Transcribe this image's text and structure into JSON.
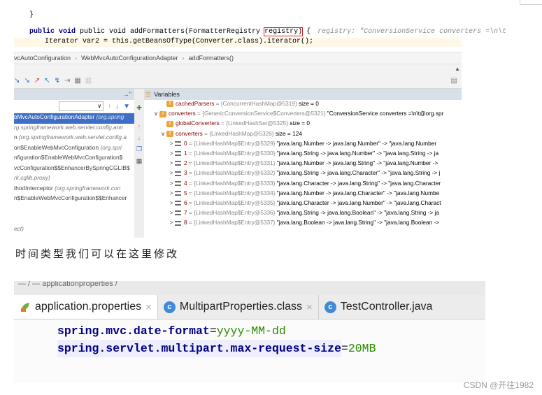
{
  "code": {
    "line1": "}",
    "line2_pre": "public void addFormatters(FormatterRegistry ",
    "line2_boxed": "registry)",
    "line2_post": " {",
    "line2_comment": "registry: \"ConversionService converters =\\n\\t",
    "line3": "Iterator var2 = this.getBeansOfType(Converter.class).iterator();"
  },
  "breadcrumb": {
    "items": [
      "vcAutoConfiguration",
      "WebMvcAutoConfigurationAdapter",
      "addFormatters()"
    ]
  },
  "frames": {
    "header_arrow": "→\"",
    "dropdown_label": "∨",
    "items": [
      {
        "name": "bMvcAutoConfigurationAdapter ",
        "loc": "(org.spring"
      },
      {
        "name": "",
        "loc": "rg.springframework.web.servlet.config.ann"
      },
      {
        "name": "n ",
        "loc": "(org.springframework.web.servlet.config.a"
      },
      {
        "name": "on$EnableWebMvcConfiguration ",
        "loc": "(org.spri"
      },
      {
        "name": "nfiguration$EnableWebMvcConfiguration$",
        "loc": ""
      },
      {
        "name": "vcConfiguration$$EnhancerBySpringCGLIB$",
        "loc": ""
      },
      {
        "name": "",
        "loc": "rk.cglib.proxy)"
      },
      {
        "name": "thodInterceptor ",
        "loc": "(org.springframework.con"
      },
      {
        "name": "n$EnableWebMvcConfiguration$$Enhancer",
        "loc": ""
      },
      {
        "name": "",
        "loc": ""
      },
      {
        "name": "",
        "loc": ""
      },
      {
        "name": "",
        "loc": "ect)"
      }
    ]
  },
  "variables": {
    "title": "Variables",
    "rows": [
      {
        "arrow": "",
        "icon": "f",
        "name": "cachedParsers",
        "ref": " = {ConcurrentHashMap@5319} ",
        "val": " size = 0"
      },
      {
        "arrow": "∨",
        "icon": "f",
        "name": "converters",
        "ref": " = {GenericConversionService$Converters@5321} ",
        "val": "\"ConversionService converters =\\n\\t@org.spr"
      },
      {
        "arrow": "",
        "icon": "f",
        "name": "globalConverters",
        "ref": " = {LinkedHashSet@5325} ",
        "val": " size = 0"
      },
      {
        "arrow": "∨",
        "icon": "f",
        "name": "converters",
        "ref": " = {LinkedHashMap@5326} ",
        "val": " size = 124"
      },
      {
        "arrow": ">",
        "icon": "arr",
        "name": "0",
        "ref": " = {LinkedHashMap$Entry@5329} ",
        "val": "\"java.lang.Number -> java.lang.Number\" -> \"java.lang.Number"
      },
      {
        "arrow": ">",
        "icon": "arr",
        "name": "1",
        "ref": " = {LinkedHashMap$Entry@5330} ",
        "val": "\"java.lang.String -> java.lang.Number\" -> \"java.lang.String -> ja"
      },
      {
        "arrow": ">",
        "icon": "arr",
        "name": "2",
        "ref": " = {LinkedHashMap$Entry@5331} ",
        "val": "\"java.lang.Number -> java.lang.String\" -> \"java.lang.Number ->"
      },
      {
        "arrow": ">",
        "icon": "arr",
        "name": "3",
        "ref": " = {LinkedHashMap$Entry@5332} ",
        "val": "\"java.lang.String -> java.lang.Character\" -> \"java.lang.String -> j"
      },
      {
        "arrow": ">",
        "icon": "arr",
        "name": "4",
        "ref": " = {LinkedHashMap$Entry@5333} ",
        "val": "\"java.lang.Character -> java.lang.String\" -> \"java.lang.Character"
      },
      {
        "arrow": ">",
        "icon": "arr",
        "name": "5",
        "ref": " = {LinkedHashMap$Entry@5334} ",
        "val": "\"java.lang.Number -> java.lang.Character\" -> \"java.lang.Numbe"
      },
      {
        "arrow": ">",
        "icon": "arr",
        "name": "6",
        "ref": " = {LinkedHashMap$Entry@5335} ",
        "val": "\"java.lang.Character -> java.lang.Number\" -> \"java.lang.Charact"
      },
      {
        "arrow": ">",
        "icon": "arr",
        "name": "7",
        "ref": " = {LinkedHashMap$Entry@5336} ",
        "val": "\"java.lang.String -> java.lang.Boolean\" -> \"java.lang.String -> ja"
      },
      {
        "arrow": ">",
        "icon": "arr",
        "name": "8",
        "ref": " = {LinkedHashMap$Entry@5337} ",
        "val": "\"java.lang.Boolean -> java.lang.String\" -> \"java.lang.Boolean ->"
      }
    ]
  },
  "caption": "时间类型我们可以在这里修改",
  "editor": {
    "breadcrumb_partial": "— / — applicationproperties /",
    "tabs": [
      {
        "label": "application.properties",
        "close": "×",
        "icon": "leaf"
      },
      {
        "label": "MultipartProperties.class",
        "close": "×",
        "icon": "c"
      },
      {
        "label": "TestController.java",
        "close": "",
        "icon": "c"
      }
    ],
    "lines": [
      {
        "key": "spring.mvc.date-format",
        "eq": "=",
        "value": "yyyy-MM-dd"
      },
      {
        "key": "spring.servlet.multipart.max-request-size",
        "eq": "=",
        "value": "20MB"
      }
    ]
  },
  "watermark": "CSDN @开往1982",
  "colors": {
    "accent": "#3d6fc7",
    "highlight_box": "#e0241b",
    "prop_key": "#000080",
    "prop_value": "#2a8a00"
  }
}
